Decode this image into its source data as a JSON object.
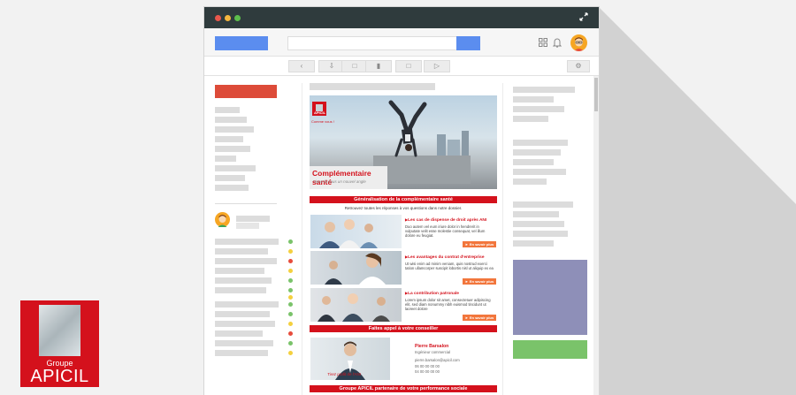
{
  "toolbar": {
    "back_icon": "back-icon",
    "archive_icon": "archive-icon",
    "spam_icon": "spam-icon",
    "delete_icon": "trash-icon",
    "folder_icon": "folder-icon",
    "label_icon": "label-icon",
    "settings_icon": "gear-icon"
  },
  "colors": {
    "titlebar": "#2f3b3d",
    "accent_blue": "#5b8def",
    "compose_red": "#dd4b39",
    "brand_red": "#d4111c",
    "button_orange": "#f2763c",
    "purple_block": "#8e8fb8",
    "green_block": "#7ac36a"
  },
  "email": {
    "hero": {
      "logo_text": "APICIL",
      "tagline": "Comme vous !",
      "title": "Complémentaire santé",
      "subtitle": "Vivez-la sous un nouvel angle"
    },
    "section1_title": "Généralisation de la complémentaire santé",
    "intro": "Retrouvez toutes les réponses à vos questions dans notre dossier.",
    "rows": [
      {
        "title": "Les cas de dispense de droit après ANI",
        "text": "Duo autem vel eum iriure dolor in hendrerit in vulputate velit esse molestie consequat, vel illum dolore eu feugiat.",
        "button": "En savoir plus"
      },
      {
        "title": "Les avantages du contrat d'entreprise",
        "text": "Ut wisi enim ad minim veniam, quis nostrud exerci tation ullamcorper suscipit lobortis nisl ut aliquip ex ea",
        "button": "En savoir plus"
      },
      {
        "title": "La contribution patronale",
        "text": "Lorem ipsum dolor sit amet, consectetuer adipiscing elit, sed diam nonummy nibh euismod tincidunt ut laoreet dolore",
        "button": "En savoir plus"
      }
    ],
    "section2_title": "Faites appel à votre conseiller",
    "contact": {
      "caption": "Tirez profit de l'ANI",
      "name": "Pierre Barsalon",
      "role": "Ingénieur commercial",
      "email": "pierre.barsalon@apicil.com",
      "phone1": "06 00 00 00 00",
      "phone2": "04 00 00 00 00"
    },
    "section3_title": "Groupe APICIL partenaire de votre performance sociale"
  },
  "brand": {
    "line1": "Groupe",
    "line2": "APICIL"
  }
}
